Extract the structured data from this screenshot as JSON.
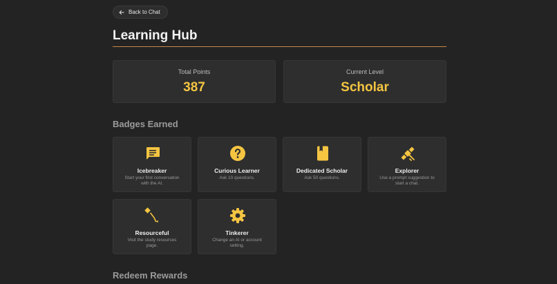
{
  "back_button": {
    "label": "Back to Chat",
    "icon": "arrow-left-icon"
  },
  "page_title": "Learning Hub",
  "stats": [
    {
      "label": "Total Points",
      "value": "387"
    },
    {
      "label": "Current Level",
      "value": "Scholar"
    }
  ],
  "sections": {
    "badges_title": "Badges Earned",
    "rewards_title": "Redeem Rewards"
  },
  "badges": [
    {
      "name": "Icebreaker",
      "description": "Start your first conversation with the AI.",
      "icon": "chat-bubble-icon"
    },
    {
      "name": "Curious Learner",
      "description": "Ask 10 questions.",
      "icon": "question-circle-icon"
    },
    {
      "name": "Dedicated Scholar",
      "description": "Ask 50 questions.",
      "icon": "book-icon"
    },
    {
      "name": "Explorer",
      "description": "Use a prompt suggestion to start a chat.",
      "icon": "satellite-icon"
    },
    {
      "name": "Resourceful",
      "description": "Visit the study resources page.",
      "icon": "pen-nib-icon"
    },
    {
      "name": "Tinkerer",
      "description": "Change an AI or account setting.",
      "icon": "gear-icon"
    }
  ],
  "colors": {
    "accent": "#f5c542",
    "rule": "#c98a46",
    "background": "#232323",
    "card": "#2e2e2e"
  }
}
